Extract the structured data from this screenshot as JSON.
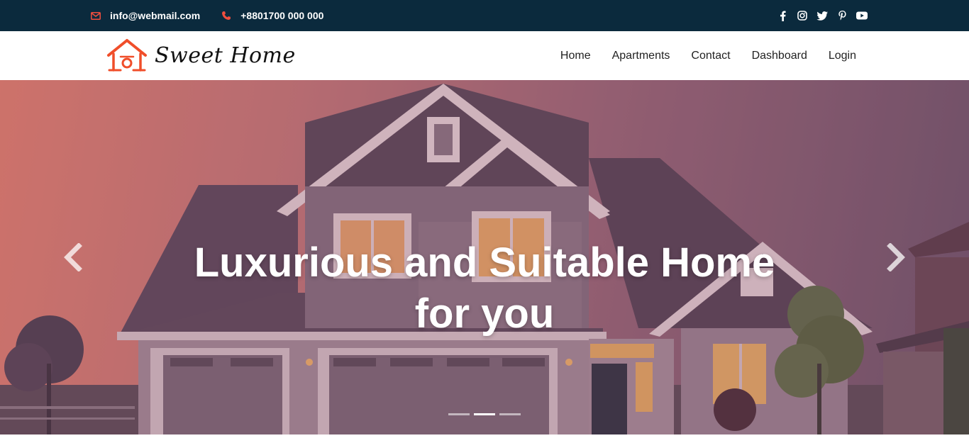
{
  "topbar": {
    "email": "info@webmail.com",
    "phone": "+8801700 000 000",
    "social_icons": [
      "facebook-icon",
      "instagram-icon",
      "twitter-icon",
      "pinterest-icon",
      "youtube-icon"
    ],
    "icon_color": "#f04e3e"
  },
  "brand": {
    "name": "Sweet Home",
    "logo_icon": "house-icon",
    "logo_color": "#f04e2a"
  },
  "nav": {
    "items": [
      {
        "label": "Home"
      },
      {
        "label": "Apartments"
      },
      {
        "label": "Contact"
      },
      {
        "label": "Dashboard"
      },
      {
        "label": "Login"
      }
    ]
  },
  "hero": {
    "headline_line1": "Luxurious and Suitable Home",
    "headline_line2": "for you",
    "prev_icon": "chevron-left-icon",
    "next_icon": "chevron-right-icon",
    "slides_total": 3,
    "active_slide": 2
  },
  "colors": {
    "topbar_bg": "#0b2a3d",
    "accent": "#f04e3e"
  }
}
